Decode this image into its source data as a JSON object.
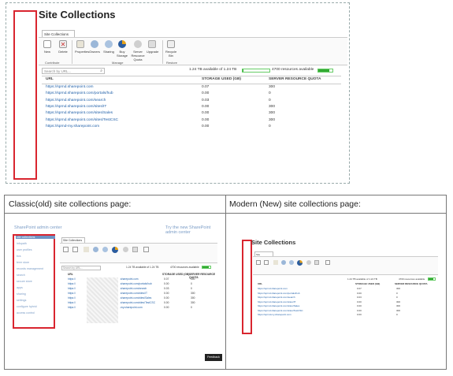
{
  "main": {
    "title": "Site Collections",
    "tab": "Site Collections",
    "ribbon": {
      "buttons": [
        "New",
        "Delete",
        "Properties",
        "Owners",
        "Sharing",
        "Buy Storage",
        "Server Resource Quota",
        "Upgrade",
        "Recycle Bin"
      ],
      "groups": [
        "Contribute",
        "Manage",
        "Restore"
      ]
    },
    "search_placeholder": "Search by URL...",
    "storage_text": "1.24 TB available of 1.24 TB",
    "resources_text": "4700 resources available",
    "columns": [
      "URL",
      "STORAGE USED (GB)",
      "SERVER RESOURCE QUOTA"
    ],
    "rows": [
      {
        "url": "https://sprnd.sharepoint.com",
        "storage": "0.07",
        "quota": "300"
      },
      {
        "url": "https://sprnd.sharepoint.com/portals/hub",
        "storage": "0.00",
        "quota": "0"
      },
      {
        "url": "https://sprnd.sharepoint.com/search",
        "storage": "0.03",
        "quota": "0"
      },
      {
        "url": "https://sprnd.sharepoint.com/sites/IT",
        "storage": "0.00",
        "quota": "300"
      },
      {
        "url": "https://sprnd.sharepoint.com/sites/Sales",
        "storage": "0.00",
        "quota": "300"
      },
      {
        "url": "https://sprnd.sharepoint.com/sites/TestCSC",
        "storage": "0.00",
        "quota": "300"
      },
      {
        "url": "https://sprnd-my.sharepoint.com",
        "storage": "0.00",
        "quota": "0"
      }
    ]
  },
  "comparison": {
    "classic_caption": "Classic(old) site collections page:",
    "modern_caption": "Modern (New) site collections page:",
    "classic": {
      "header": "SharePoint admin center",
      "try_link": "Try the new SharePoint admin center",
      "nav": [
        "site collections",
        "infopath",
        "user profiles",
        "bcs",
        "term store",
        "records management",
        "search",
        "secure store",
        "apps",
        "sharing",
        "settings",
        "configure hybrid",
        "access control"
      ],
      "feedback": "Feedback",
      "tab": "Site Collections",
      "search_placeholder": "Search by URL...",
      "storage_text": "1.24 TB available of 1.24 TB",
      "resources_text": "4700 resources available",
      "columns": [
        "URL",
        "STORAGE USED (GB)",
        "SERVER RESOURCE QUOTA"
      ],
      "rows": [
        {
          "url": "https://",
          "url2": ".sharepoint.com",
          "storage": "0.07",
          "quota": "300"
        },
        {
          "url": "https://",
          "url2": ".sharepoint.com/portals/hub",
          "storage": "0.00",
          "quota": "0"
        },
        {
          "url": "https://",
          "url2": ".sharepoint.com/search",
          "storage": "0.03",
          "quota": "0"
        },
        {
          "url": "https://",
          "url2": ".sharepoint.com/sites/IT",
          "storage": "0.00",
          "quota": "300"
        },
        {
          "url": "https://",
          "url2": ".sharepoint.com/sites/Sales",
          "storage": "0.00",
          "quota": "300"
        },
        {
          "url": "https://",
          "url2": ".sharepoint.com/sites/TestCSC",
          "storage": "0.00",
          "quota": "300"
        },
        {
          "url": "https://",
          "url2": "-my.sharepoint.com",
          "storage": "0.00",
          "quota": "0"
        }
      ]
    },
    "modern": {
      "title": "Site Collections",
      "tab": "Site Collections",
      "storage_text": "1.24 TB available of 1.24 TB",
      "resources_text": "4700 resources available",
      "columns": [
        "URL",
        "STORAGE USED (GB)",
        "SERVER RESOURCE QUOTA"
      ],
      "rows": [
        {
          "url": "https://sprnd.sharepoint.com",
          "storage": "0.07",
          "quota": "300"
        },
        {
          "url": "https://sprnd.sharepoint.com/portals/hub",
          "storage": "0.00",
          "quota": "0"
        },
        {
          "url": "https://sprnd.sharepoint.com/search",
          "storage": "0.03",
          "quota": "0"
        },
        {
          "url": "https://sprnd.sharepoint.com/sites/IT",
          "storage": "0.00",
          "quota": "300"
        },
        {
          "url": "https://sprnd.sharepoint.com/sites/Sales",
          "storage": "0.00",
          "quota": "300"
        },
        {
          "url": "https://sprnd.sharepoint.com/sites/TestCSC",
          "storage": "0.00",
          "quota": "300"
        },
        {
          "url": "https://sprnd-my.sharepoint.com",
          "storage": "0.00",
          "quota": "0"
        }
      ]
    }
  },
  "colors": {
    "highlight": "#d9252f",
    "link": "#1f5fa8",
    "bar": "#33aa33"
  },
  "usage": {
    "storage_fraction": 0.999,
    "resources_fraction": 0.78
  }
}
